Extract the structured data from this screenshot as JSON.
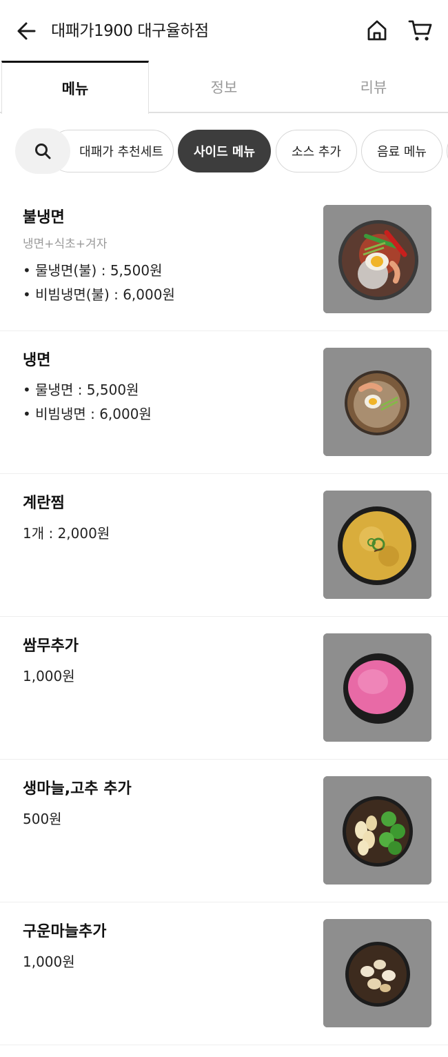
{
  "header": {
    "title": "대패가1900 대구율하점",
    "back_icon": "arrow-left-icon",
    "home_icon": "home-icon",
    "cart_icon": "cart-icon"
  },
  "tabs": [
    {
      "label": "메뉴",
      "active": true
    },
    {
      "label": "정보",
      "active": false
    },
    {
      "label": "리뷰",
      "active": false
    }
  ],
  "filters": {
    "search_icon": "search-icon",
    "chips": [
      {
        "label": "대패가 추천세트",
        "active": false
      },
      {
        "label": "사이드 메뉴",
        "active": true
      },
      {
        "label": "소스 추가",
        "active": false
      },
      {
        "label": "음료 메뉴",
        "active": false
      },
      {
        "label": "",
        "active": false
      }
    ]
  },
  "menu_items": [
    {
      "name": "불냉면",
      "description": "냉면+식초+겨자",
      "lines": [
        "• 물냉면(불) : 5,500원",
        "• 비빔냉면(불) : 6,000원"
      ],
      "image": "spicy-cold-noodle-photo"
    },
    {
      "name": "냉면",
      "description": "",
      "lines": [
        "• 물냉면 : 5,500원",
        "• 비빔냉면 : 6,000원"
      ],
      "image": "cold-noodle-photo"
    },
    {
      "name": "계란찜",
      "description": "",
      "lines": [
        "1개 : 2,000원"
      ],
      "image": "steamed-egg-photo"
    },
    {
      "name": "쌈무추가",
      "description": "",
      "lines": [
        "1,000원"
      ],
      "image": "pickled-radish-photo"
    },
    {
      "name": "생마늘,고추 추가",
      "description": "",
      "lines": [
        "500원"
      ],
      "image": "garlic-pepper-photo"
    },
    {
      "name": "구운마늘추가",
      "description": "",
      "lines": [
        "1,000원"
      ],
      "image": "roasted-garlic-photo"
    }
  ],
  "colors": {
    "accent_dark": "#3d3d3d",
    "text_muted": "#9a9a9a",
    "divider": "#eeeeee"
  }
}
